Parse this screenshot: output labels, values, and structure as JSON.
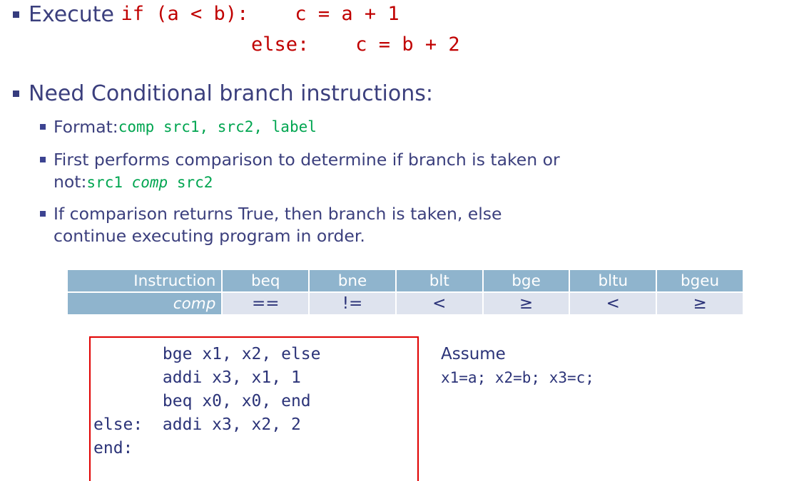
{
  "slide": {
    "bullets": [
      {
        "level": 1,
        "prefix": "Execute ",
        "code_line_1": "if (a < b):    c = a + 1",
        "code_line_2": "else:    c = b + 2"
      },
      {
        "level": 1,
        "text": "Need Conditional branch instructions:"
      }
    ],
    "sub_bullets": [
      {
        "prefix": "Format: ",
        "code": "comp src1, src2, label"
      },
      {
        "line1": "First performs comparison to determine if branch is taken or",
        "line2_prefix": "not: ",
        "line2_code_a": "src1 ",
        "line2_code_italic": "comp",
        "line2_code_b": " src2"
      },
      {
        "line1": "If comparison returns True, then branch is taken, else",
        "line2": "continue executing program in order."
      }
    ]
  },
  "table": {
    "row_labels": [
      "Instruction",
      "comp"
    ],
    "instructions": [
      "beq",
      "bne",
      "blt",
      "bge",
      "bltu",
      "bgeu"
    ],
    "comparisons": [
      "==",
      "!=",
      "<",
      "≥",
      "<",
      "≥"
    ]
  },
  "code_box": {
    "lines": [
      "       bge x1, x2, else",
      "       addi x3, x1, 1",
      "       beq x0, x0, end",
      "else:  addi x3, x2, 2",
      "end:"
    ],
    "text": "       bge x1, x2, else\n       addi x3, x1, 1\n       beq x0, x0, end\nelse:  addi x3, x2, 2\nend:"
  },
  "assume": {
    "title": "Assume",
    "mapping": "x1=a; x2=b; x3=c;"
  },
  "colors": {
    "text_navy": "#3b3f7d",
    "code_red": "#c00000",
    "code_green": "#00a550",
    "table_header_blue": "#8fb4cd",
    "table_cell_blue": "#dee3ee",
    "box_border_red": "#e00000"
  }
}
